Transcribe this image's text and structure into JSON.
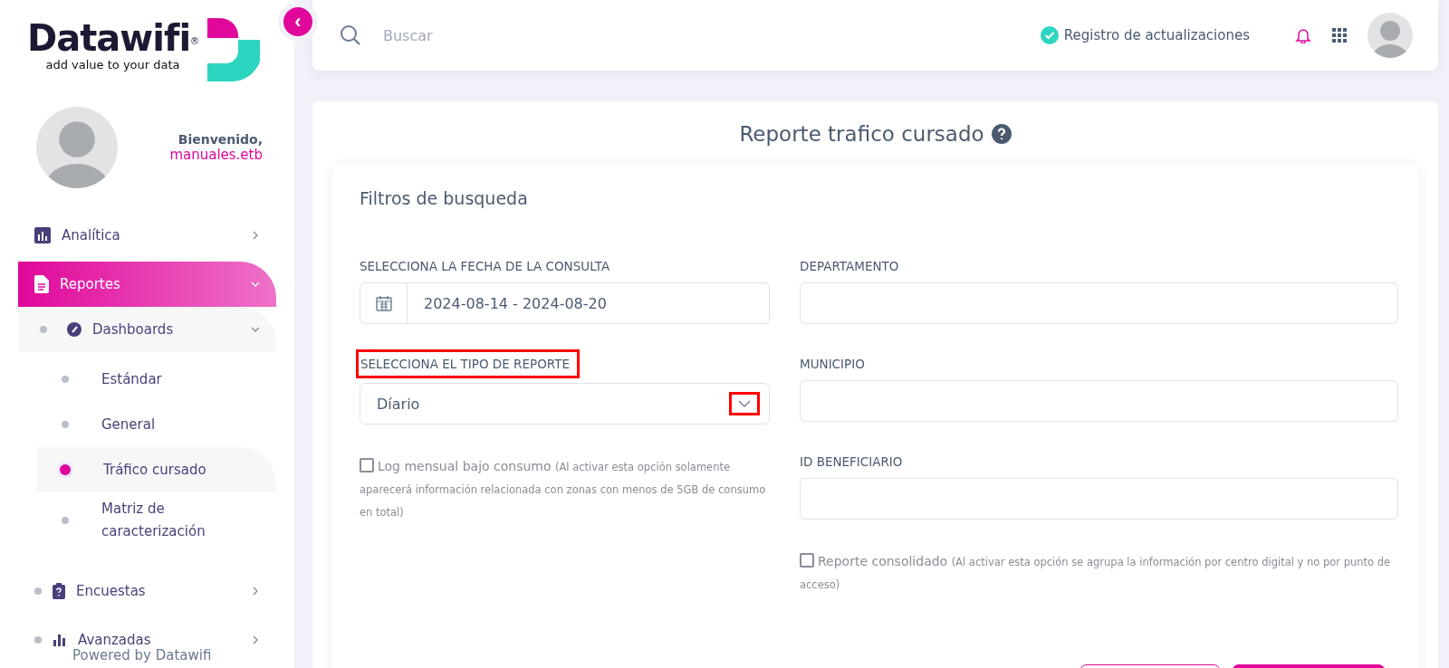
{
  "sidebar": {
    "collapse_button": "‹",
    "logo": {
      "name": "Datawifi$^{®}$",
      "tagline": "add value to your data"
    },
    "welcome": "Bienvenido,",
    "username": "manuales.etb",
    "menu": [
      {
        "label": "Analítica",
        "expanded": false,
        "selected": false
      },
      {
        "label": "Reportes",
        "expanded": true,
        "selected": true,
        "children": [
          {
            "label": "Dashboards",
            "expanded": true,
            "children": [
              {
                "label": "Estándar",
                "selected": false
              },
              {
                "label": "General",
                "selected": false
              },
              {
                "label": "Tráfico cursado",
                "selected": true
              },
              {
                "label": "Matriz de caracterización",
                "selected": false
              }
            ]
          }
        ]
      },
      {
        "label": "Encuestas",
        "expanded": false,
        "selected": false
      },
      {
        "label": "Avanzadas",
        "expanded": false,
        "selected": false
      }
    ],
    "footer": "Powered by Datawifi"
  },
  "topbar": {
    "search": {
      "placeholder": "Buscar"
    },
    "updates_link": "Registro de actualizaciones"
  },
  "page": {
    "title": "Reporte trafico cursado",
    "filters": {
      "title": "Filtros de busqueda",
      "left": [
        {
          "kind": "date",
          "label": "SELECCIONA LA FECHA DE LA CONSULTA",
          "value": "2024-08-14 - 2024-08-20",
          "highlighted": false
        },
        {
          "kind": "select",
          "label": "SELECCIONA EL TIPO DE REPORTE",
          "value": "Díario",
          "highlighted": true,
          "caret_highlighted": true
        },
        {
          "kind": "checkbox",
          "label": "Log mensual bajo consumo",
          "note": "(Al activar esta opción solamente aparecerá información relacionada con zonas con menos de 5GB de consumo en total)",
          "checked": false
        }
      ],
      "right": [
        {
          "kind": "text",
          "label": "DEPARTAMENTO",
          "highlighted": false
        },
        {
          "kind": "text",
          "label": "MUNICIPIO",
          "highlighted": false
        },
        {
          "kind": "text",
          "label": "ID BENEFICIARIO",
          "highlighted": false
        },
        {
          "kind": "checkbox",
          "label": "Reporte consolidado",
          "note": "(Al activar esta opción se agrupa la información por centro digital y no por punto de acceso)",
          "checked": false
        }
      ]
    },
    "buttons": [
      {
        "kind": "outline"
      },
      {
        "kind": "filled"
      }
    ]
  }
}
